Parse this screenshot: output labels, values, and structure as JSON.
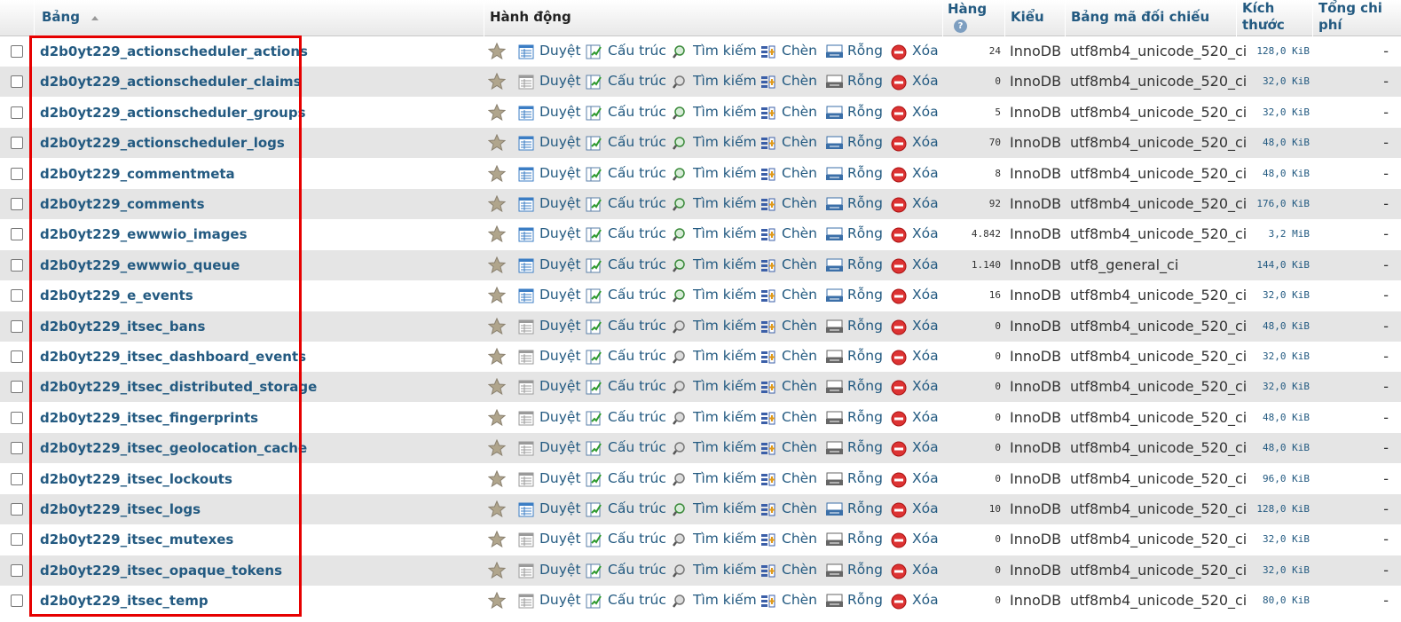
{
  "header": {
    "bang": "Bảng",
    "hanh_dong": "Hành động",
    "hang": "Hàng",
    "kieu": "Kiểu",
    "bang_ma_doi_chieu": "Bảng mã đối chiếu",
    "kich_thuoc": "Kích thước",
    "tong_chi_phi": "Tổng chi phí"
  },
  "actions": {
    "duyet": "Duyệt",
    "cau_truc": "Cấu trúc",
    "tim_kiem": "Tìm kiếm",
    "chen": "Chèn",
    "rong": "Rỗng",
    "xoa": "Xóa"
  },
  "colors": {
    "link": "#235a81",
    "highlight_border": "#e60000",
    "row_alt": "#e5e5e5"
  },
  "rows": [
    {
      "name": "d2b0yt229_actionscheduler_actions",
      "rows": "24",
      "type": "InnoDB",
      "collation": "utf8mb4_unicode_520_ci",
      "size": "128,0 KiB",
      "overhead": "-",
      "has_rows": true
    },
    {
      "name": "d2b0yt229_actionscheduler_claims",
      "rows": "0",
      "type": "InnoDB",
      "collation": "utf8mb4_unicode_520_ci",
      "size": "32,0 KiB",
      "overhead": "-",
      "has_rows": false
    },
    {
      "name": "d2b0yt229_actionscheduler_groups",
      "rows": "5",
      "type": "InnoDB",
      "collation": "utf8mb4_unicode_520_ci",
      "size": "32,0 KiB",
      "overhead": "-",
      "has_rows": true
    },
    {
      "name": "d2b0yt229_actionscheduler_logs",
      "rows": "70",
      "type": "InnoDB",
      "collation": "utf8mb4_unicode_520_ci",
      "size": "48,0 KiB",
      "overhead": "-",
      "has_rows": true
    },
    {
      "name": "d2b0yt229_commentmeta",
      "rows": "8",
      "type": "InnoDB",
      "collation": "utf8mb4_unicode_520_ci",
      "size": "48,0 KiB",
      "overhead": "-",
      "has_rows": true
    },
    {
      "name": "d2b0yt229_comments",
      "rows": "92",
      "type": "InnoDB",
      "collation": "utf8mb4_unicode_520_ci",
      "size": "176,0 KiB",
      "overhead": "-",
      "has_rows": true
    },
    {
      "name": "d2b0yt229_ewwwio_images",
      "rows": "4.842",
      "type": "InnoDB",
      "collation": "utf8mb4_unicode_520_ci",
      "size": "3,2 MiB",
      "overhead": "-",
      "has_rows": true
    },
    {
      "name": "d2b0yt229_ewwwio_queue",
      "rows": "1.140",
      "type": "InnoDB",
      "collation": "utf8_general_ci",
      "size": "144,0 KiB",
      "overhead": "-",
      "has_rows": true
    },
    {
      "name": "d2b0yt229_e_events",
      "rows": "16",
      "type": "InnoDB",
      "collation": "utf8mb4_unicode_520_ci",
      "size": "32,0 KiB",
      "overhead": "-",
      "has_rows": true
    },
    {
      "name": "d2b0yt229_itsec_bans",
      "rows": "0",
      "type": "InnoDB",
      "collation": "utf8mb4_unicode_520_ci",
      "size": "48,0 KiB",
      "overhead": "-",
      "has_rows": false
    },
    {
      "name": "d2b0yt229_itsec_dashboard_events",
      "rows": "0",
      "type": "InnoDB",
      "collation": "utf8mb4_unicode_520_ci",
      "size": "32,0 KiB",
      "overhead": "-",
      "has_rows": false
    },
    {
      "name": "d2b0yt229_itsec_distributed_storage",
      "rows": "0",
      "type": "InnoDB",
      "collation": "utf8mb4_unicode_520_ci",
      "size": "32,0 KiB",
      "overhead": "-",
      "has_rows": false
    },
    {
      "name": "d2b0yt229_itsec_fingerprints",
      "rows": "0",
      "type": "InnoDB",
      "collation": "utf8mb4_unicode_520_ci",
      "size": "48,0 KiB",
      "overhead": "-",
      "has_rows": false
    },
    {
      "name": "d2b0yt229_itsec_geolocation_cache",
      "rows": "0",
      "type": "InnoDB",
      "collation": "utf8mb4_unicode_520_ci",
      "size": "48,0 KiB",
      "overhead": "-",
      "has_rows": false
    },
    {
      "name": "d2b0yt229_itsec_lockouts",
      "rows": "0",
      "type": "InnoDB",
      "collation": "utf8mb4_unicode_520_ci",
      "size": "96,0 KiB",
      "overhead": "-",
      "has_rows": false
    },
    {
      "name": "d2b0yt229_itsec_logs",
      "rows": "10",
      "type": "InnoDB",
      "collation": "utf8mb4_unicode_520_ci",
      "size": "128,0 KiB",
      "overhead": "-",
      "has_rows": true
    },
    {
      "name": "d2b0yt229_itsec_mutexes",
      "rows": "0",
      "type": "InnoDB",
      "collation": "utf8mb4_unicode_520_ci",
      "size": "32,0 KiB",
      "overhead": "-",
      "has_rows": false
    },
    {
      "name": "d2b0yt229_itsec_opaque_tokens",
      "rows": "0",
      "type": "InnoDB",
      "collation": "utf8mb4_unicode_520_ci",
      "size": "32,0 KiB",
      "overhead": "-",
      "has_rows": false
    },
    {
      "name": "d2b0yt229_itsec_temp",
      "rows": "0",
      "type": "InnoDB",
      "collation": "utf8mb4_unicode_520_ci",
      "size": "80,0 KiB",
      "overhead": "-",
      "has_rows": false
    }
  ]
}
